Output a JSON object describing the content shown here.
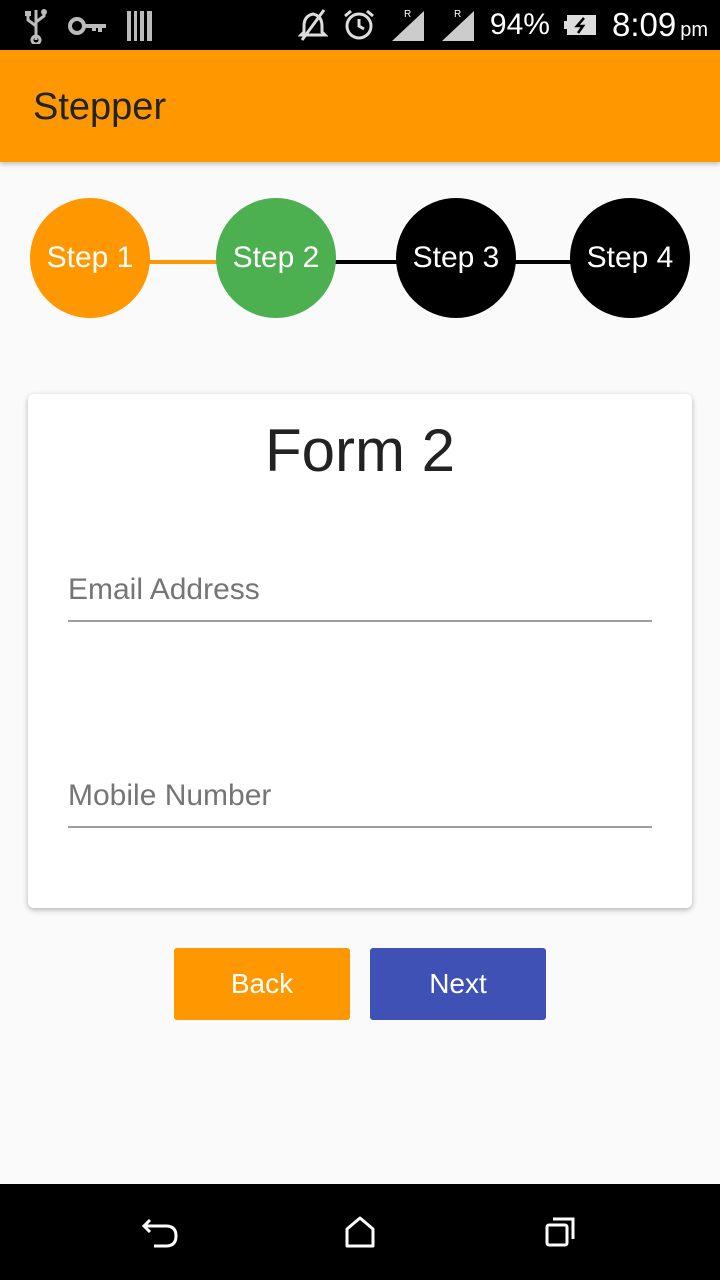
{
  "status_bar": {
    "battery": "94%",
    "time": "8:09",
    "ampm": "pm",
    "icons": [
      "usb-icon",
      "key-icon",
      "barcode-icon",
      "mute-icon",
      "alarm-icon",
      "signal-icon",
      "signal-icon",
      "battery-icon"
    ]
  },
  "app_bar": {
    "title": "Stepper"
  },
  "stepper": {
    "steps": [
      {
        "label": "Step 1",
        "color": "#ff9800"
      },
      {
        "label": "Step 2",
        "color": "#4caf50"
      },
      {
        "label": "Step 3",
        "color": "#000000"
      },
      {
        "label": "Step 4",
        "color": "#000000"
      }
    ],
    "connector_colors": [
      "#ff9800",
      "#000000",
      "#000000"
    ]
  },
  "form": {
    "title": "Form 2",
    "email": {
      "placeholder": "Email Address",
      "value": ""
    },
    "mobile": {
      "placeholder": "Mobile Number",
      "value": ""
    }
  },
  "buttons": {
    "back": {
      "label": "Back",
      "color": "#ff9800"
    },
    "next": {
      "label": "Next",
      "color": "#3f51b5"
    }
  },
  "nav_bar": {
    "icons": [
      "back-nav-icon",
      "home-nav-icon",
      "recents-nav-icon"
    ]
  }
}
